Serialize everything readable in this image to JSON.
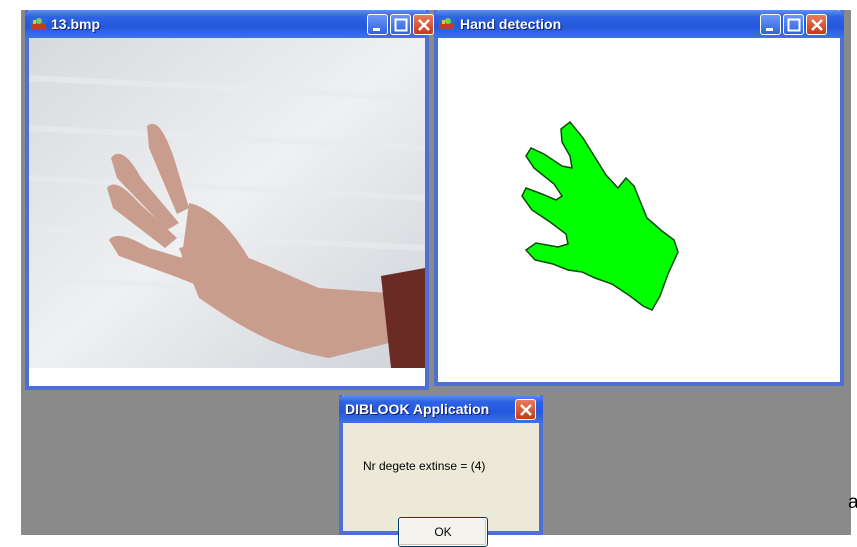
{
  "windows": {
    "image": {
      "title": "13.bmp"
    },
    "detection": {
      "title": "Hand detection"
    }
  },
  "dialog": {
    "title": "DIBLOOK Application",
    "message": "Nr degete extinse = (4)",
    "ok_label": "OK"
  },
  "trailing_text": "a",
  "icons": {
    "app": "paint-app-icon",
    "minimize": "minimize-icon",
    "maximize": "maximize-icon",
    "close": "close-icon"
  },
  "colors": {
    "titlebar": "#2557de",
    "close_button": "#d2482a",
    "hand_fill": "#00ff00",
    "desktop": "#8a8a8a"
  }
}
